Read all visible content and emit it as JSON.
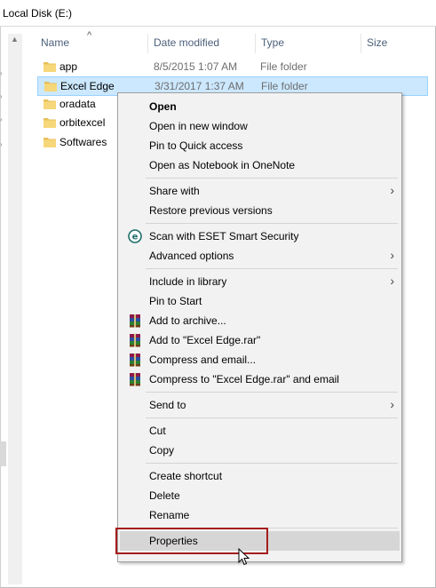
{
  "address": {
    "path": "Local Disk (E:)"
  },
  "columns": {
    "name": "Name",
    "date": "Date modified",
    "type": "Type",
    "size": "Size",
    "sort_indicator": "^"
  },
  "files": [
    {
      "name": "app",
      "date": "8/5/2015 1:07 AM",
      "type": "File folder"
    },
    {
      "name": "Excel Edge",
      "date": "3/31/2017 1:37 AM",
      "type": "File folder"
    },
    {
      "name": "oradata",
      "date": "",
      "type": ""
    },
    {
      "name": "orbitexcel",
      "date": "",
      "type": ""
    },
    {
      "name": "Softwares",
      "date": "",
      "type": ""
    }
  ],
  "context_menu": {
    "items": [
      {
        "label": "Open",
        "bold": true
      },
      {
        "label": "Open in new window"
      },
      {
        "label": "Pin to Quick access"
      },
      {
        "label": "Open as Notebook in OneNote"
      },
      {
        "label": "Share with",
        "submenu": true
      },
      {
        "label": "Restore previous versions"
      },
      {
        "label": "Scan with ESET Smart Security",
        "icon": "eset-icon"
      },
      {
        "label": "Advanced options",
        "submenu": true
      },
      {
        "label": "Include in library",
        "submenu": true
      },
      {
        "label": "Pin to Start"
      },
      {
        "label": "Add to archive...",
        "icon": "winrar-icon"
      },
      {
        "label": "Add to \"Excel Edge.rar\"",
        "icon": "winrar-icon"
      },
      {
        "label": "Compress and email...",
        "icon": "winrar-icon"
      },
      {
        "label": "Compress to \"Excel Edge.rar\" and email",
        "icon": "winrar-icon"
      },
      {
        "label": "Send to",
        "submenu": true
      },
      {
        "label": "Cut"
      },
      {
        "label": "Copy"
      },
      {
        "label": "Create shortcut"
      },
      {
        "label": "Delete"
      },
      {
        "label": "Rename"
      },
      {
        "label": "Properties",
        "highlighted": true
      }
    ],
    "submenu_arrow": "›"
  },
  "colors": {
    "selection": "#cce8ff",
    "highlight_border": "#a51d1d",
    "folder": "#e8c05a"
  }
}
